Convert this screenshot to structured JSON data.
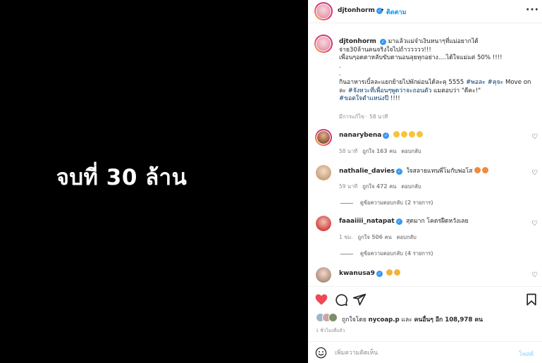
{
  "media": {
    "text": "จบที่ 30 ล้าน",
    "background": "#000000"
  },
  "header": {
    "username": "djtonhorm",
    "separator": "•",
    "follow_label": "ติดตาม",
    "more_icon": "more-horizontal-icon"
  },
  "caption": {
    "username": "djtonhorm",
    "lines": [
      "มาแล้วแม่จ๋าเงินหนาๆที่แม่อยากได้",
      "จ่าย30ล้านคนจริงใจไปถ้าววววว!!!",
      "เพื่อนๆอดตาหลับขับดานอนลุยทุกอย่าง....ได้ใจแม่แต่ 50% !!!!",
      ".",
      "."
    ],
    "last_line_prefix": "กินอาหารเบิ้ลละแยกย้ายไปพักผ่อนได้ละคุ 5555 ",
    "tag1": "#พอละ",
    "tag2": "#คุจะ",
    "last_line_mid": " Move on ละ ",
    "tag3": "#จังหวะที่เพื่อนๆพูดว่าจะถอนตัว",
    "last_line_end": " แมตอบว่า \"ดีคะ!\"",
    "tag4": "#ขอตใจตำแหน่งปี",
    "last_line_tail": " !!!!",
    "meta": "มีการแก้ไข · 58 นาที"
  },
  "comments": [
    {
      "username": "nanarybena",
      "text": "",
      "emoji_count": 4,
      "time": "58 นาที",
      "likes": "ถูกใจ 163 คน",
      "reply": "ตอบกลับ"
    },
    {
      "username": "nathalie_davies",
      "text": "ใจสลายแทนพี่โมกับพ่อโส",
      "emoji_count": 2,
      "time": "59 นาที",
      "likes": "ถูกใจ 472 คน",
      "reply": "ตอบกลับ",
      "replies": "ดูข้อความตอบกลับ (2 รายการ)"
    },
    {
      "username": "faaaiiii_natapat",
      "text": "สุดมาก โคตรฝืดหวังเลย",
      "emoji_count": 0,
      "time": "1 ชม.",
      "likes": "ถูกใจ 506 คน",
      "reply": "ตอบกลับ",
      "replies": "ดูข้อความตอบกลับ (4 รายการ)"
    },
    {
      "username": "kwanusa9",
      "text": "",
      "emoji_count": 2,
      "time": "",
      "likes": "",
      "reply": ""
    }
  ],
  "actions": {
    "like_icon": "heart-filled-icon",
    "comment_icon": "comment-icon",
    "share_icon": "send-icon",
    "save_icon": "bookmark-icon",
    "like_color": "#ed4956"
  },
  "likes": {
    "prefix": "ถูกใจโดย ",
    "user": "nycoap.p",
    "middle": " และ ",
    "others": "คนอื่นๆ อีก 108,978 คน"
  },
  "post_time": "1 ชั่วโมงที่แล้ว",
  "comment_box": {
    "emoji_icon": "smiley-icon",
    "placeholder": "เพิ่มความคิดเห็น",
    "post_label": "โพสต์"
  },
  "colors": {
    "verified": "#3897f0",
    "link": "#0095f6",
    "hashtag": "#00376b",
    "muted": "#8e8e8e"
  }
}
